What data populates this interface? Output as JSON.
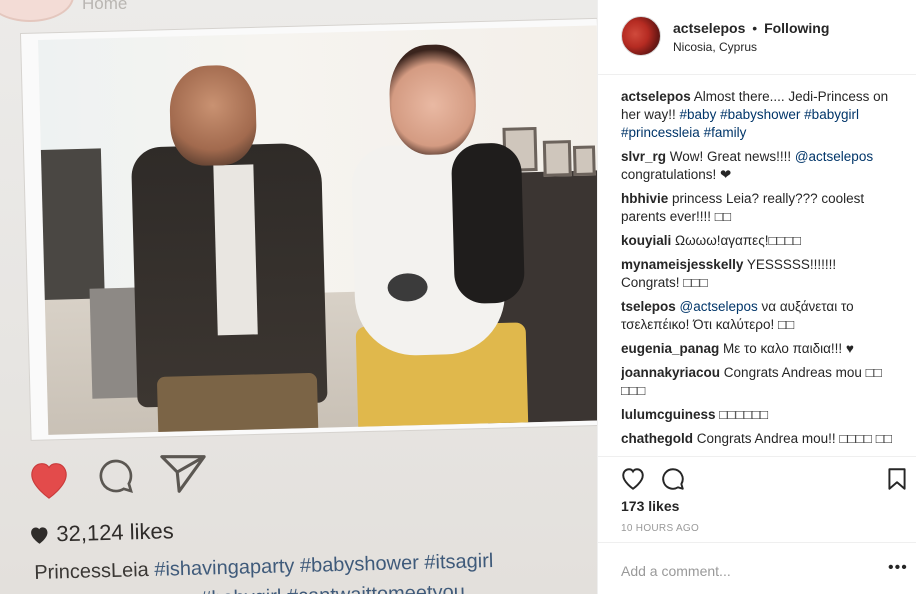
{
  "photo": {
    "home_label": "Home",
    "likes_text": "32,124 likes",
    "caption_name": "PrincessLeia",
    "caption_tags": "#ishavingaparty #babyshower #itsagirl",
    "caption_line2": "#babygirl #cantwaittomeetyou",
    "heart_color": "#e34b4b"
  },
  "post": {
    "username": "actselepos",
    "separator": "•",
    "follow_status": "Following",
    "location": "Nicosia, Cyprus",
    "likes": "173 likes",
    "time": "10 HOURS AGO",
    "add_comment_placeholder": "Add a comment...",
    "more_label": "•••"
  },
  "comments": [
    {
      "user": "actselepos",
      "parts": [
        {
          "t": "text",
          "v": " Almost there.... Jedi-Princess on her way!! "
        },
        {
          "t": "tag",
          "v": "#baby"
        },
        {
          "t": "text",
          "v": " "
        },
        {
          "t": "tag",
          "v": "#babyshower"
        },
        {
          "t": "text",
          "v": " "
        },
        {
          "t": "tag",
          "v": "#babygirl"
        },
        {
          "t": "text",
          "v": " "
        },
        {
          "t": "tag",
          "v": "#princessleia"
        },
        {
          "t": "text",
          "v": " "
        },
        {
          "t": "tag",
          "v": "#family"
        }
      ]
    },
    {
      "user": "slvr_rg",
      "parts": [
        {
          "t": "text",
          "v": " Wow! Great news!!!! "
        },
        {
          "t": "tag",
          "v": "@actselepos"
        },
        {
          "t": "text",
          "v": " congratulations! ❤"
        }
      ]
    },
    {
      "user": "hbhivie",
      "parts": [
        {
          "t": "text",
          "v": " princess Leia? really??? coolest parents ever!!!! □□"
        }
      ]
    },
    {
      "user": "kouyiali",
      "parts": [
        {
          "t": "text",
          "v": " Ωωωω!αγαπες!□□□□"
        }
      ]
    },
    {
      "user": "mynameisjesskelly",
      "parts": [
        {
          "t": "text",
          "v": " YESSSSS!!!!!!! Congrats! □□□"
        }
      ]
    },
    {
      "user": "tselepos",
      "parts": [
        {
          "t": "text",
          "v": " "
        },
        {
          "t": "tag",
          "v": "@actselepos"
        },
        {
          "t": "text",
          "v": " να αυξάνεται το τσελεπέικο! Ότι καλύτερο! □□"
        }
      ]
    },
    {
      "user": "eugenia_panag",
      "parts": [
        {
          "t": "text",
          "v": " Με το καλο παιδια!!! ♥"
        }
      ]
    },
    {
      "user": "joannakyriacou",
      "parts": [
        {
          "t": "text",
          "v": " Congrats Andreas mou □□ □□□"
        }
      ]
    },
    {
      "user": "lulumcguiness",
      "parts": [
        {
          "t": "text",
          "v": " □□□□□□"
        }
      ]
    },
    {
      "user": "chathegold",
      "parts": [
        {
          "t": "text",
          "v": " Congrats Andrea mou!! □□□□ □□"
        }
      ]
    }
  ],
  "icons": {
    "like": "heart-outline-icon",
    "comment": "speech-bubble-icon",
    "save": "bookmark-icon"
  }
}
